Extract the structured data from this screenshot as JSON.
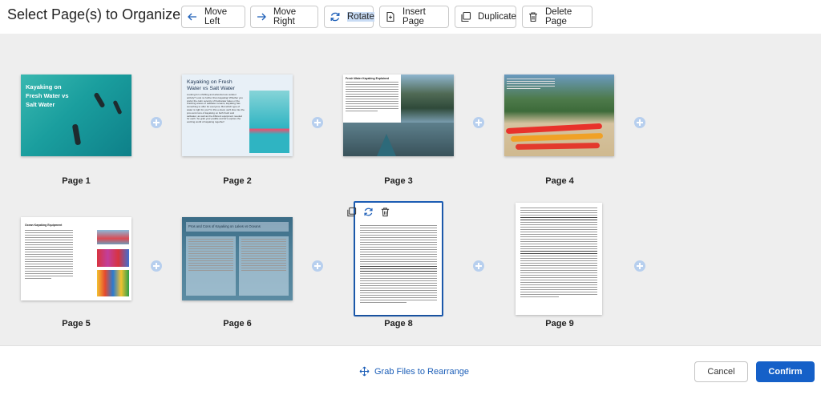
{
  "header": {
    "title": "Select Page(s) to Organize",
    "buttons": {
      "move_left": "Move Left",
      "move_right": "Move Right",
      "rotate": "Rotate",
      "insert_page": "Insert Page",
      "duplicate": "Duplicate",
      "delete_page": "Delete Page"
    }
  },
  "pages": [
    {
      "label": "Page 1",
      "title": "Kayaking on Fresh Water vs Salt Water"
    },
    {
      "label": "Page 2",
      "title": "Kayaking on Fresh Water vs Salt Water",
      "body": "Looking for a thrilling and adventurous outdoor activity? Look no further than kayaking! Whether you prefer the calm serenity of freshwater lakes or the crashing waves of saltwater oceans, kayaking has something to offer for everyone. But which type of water is right for you? In this e-book, we'll dive into the pros and cons of kayaking on both fresh and saltwater, as well as the different equipment needed for each. So grab your paddle and let's explore the exciting world of kayaking together!"
    },
    {
      "label": "Page 3",
      "title": "Fresh Water Kayaking Explained"
    },
    {
      "label": "Page 4"
    },
    {
      "label": "Page 5",
      "title": "Ocean Kayaking Equipment"
    },
    {
      "label": "Page 6",
      "title": "Pros and Cons of Kayaking on Lakes vs Oceans"
    },
    {
      "label": "Page 8"
    },
    {
      "label": "Page 9"
    }
  ],
  "footer": {
    "grab_label": "Grab Files to Rearrange",
    "cancel_label": "Cancel",
    "confirm_label": "Confirm"
  },
  "colors": {
    "accent": "#1560c8",
    "link": "#1d5fb8",
    "canvas_bg": "#eeeeee",
    "plus_button": "#b7cfee"
  },
  "icons": {
    "move_left": "arrow-left-icon",
    "move_right": "arrow-right-icon",
    "rotate": "rotate-icon",
    "insert_page": "insert-page-icon",
    "duplicate": "duplicate-icon",
    "delete_page": "trash-icon",
    "grab": "move-arrows-icon",
    "insert_between": "plus-circle-icon"
  },
  "selected_page": "Page 8"
}
